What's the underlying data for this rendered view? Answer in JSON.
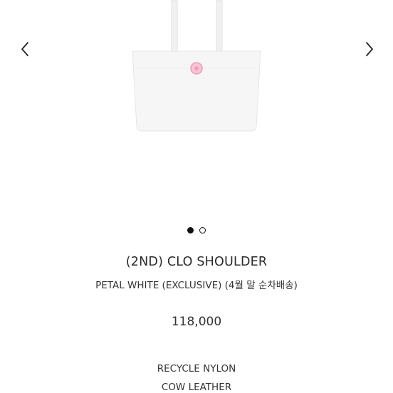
{
  "carousel": {
    "prev_icon": "chevron-left-icon",
    "next_icon": "chevron-right-icon",
    "image_alt": "white tote bag with pink flower emblem",
    "total_slides": 2,
    "active_slide": 1
  },
  "product": {
    "title": "(2ND) CLO SHOULDER",
    "subtitle": "PETAL WHITE (EXCLUSIVE) (4월 말 순차배송)",
    "price": "118,000",
    "materials": [
      "RECYCLE NYLON",
      "COW LEATHER"
    ]
  },
  "colors": {
    "bag": "#f4f4f4",
    "emblem": "#f2a7c0",
    "text": "#222222"
  }
}
